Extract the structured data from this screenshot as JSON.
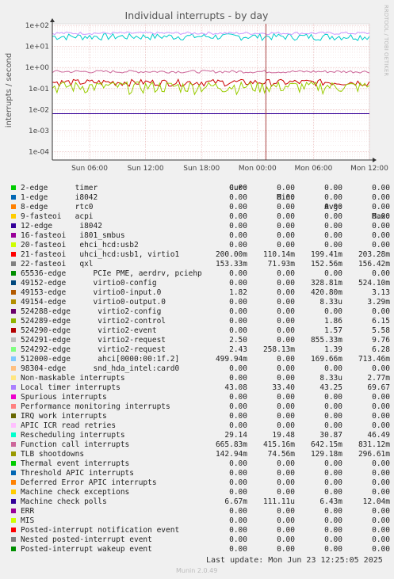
{
  "chart_data": {
    "type": "line",
    "title": "Individual interrupts - by day",
    "ylabel": "interrupts / second",
    "side_label": "RRDTOOL / TOBI OETIKER",
    "yscale": "log",
    "ylim": [
      4e-05,
      120
    ],
    "y_ticks": [
      "1e+02",
      "1e+01",
      "1e+00",
      "1e-01",
      "1e-02",
      "1e-03",
      "1e-04"
    ],
    "y_tick_values": [
      100,
      10,
      1,
      0.1,
      0.01,
      0.001,
      0.0001
    ],
    "x_ticks": [
      "Sun 06:00",
      "Sun 12:00",
      "Sun 18:00",
      "Mon 00:00",
      "Mon 06:00",
      "Mon 12:00"
    ],
    "x_tick_hours": [
      6,
      12,
      18,
      24,
      30,
      36
    ],
    "xlim_hours": [
      2,
      36
    ],
    "now_hour": 24.9,
    "series": [
      {
        "name": "Rescheduling interrupts",
        "color": "#00CCCC",
        "base": 30,
        "noise": 0.12
      },
      {
        "name": "Local timer interrupts",
        "color": "#CC99FF",
        "base": 43,
        "noise": 0.05
      },
      {
        "name": "Function call interrupts",
        "color": "#CC6699",
        "base": 0.64,
        "noise": 0.05
      },
      {
        "name": "21-fasteoi uhci_hcd:usb1, virtio1",
        "color": "#CC0000",
        "base": 0.2,
        "noise": 0.12
      },
      {
        "name": "TLB shootdowns",
        "color": "#99CC00",
        "base": 0.13,
        "noise": 0.2
      },
      {
        "name": "Machine check polls",
        "color": "#330099",
        "base": 0.0064,
        "noise": 0.0
      }
    ]
  },
  "legend": {
    "headers": {
      "cur": "Cur:",
      "min": "Min:",
      "avg": "Avg:",
      "max": "Max:"
    },
    "rows": [
      {
        "name": "2-edge      timer",
        "color": "#00CC00",
        "cur": "0.00",
        "min": "0.00",
        "avg": "0.00",
        "max": "0.00"
      },
      {
        "name": "1-edge      i8042",
        "color": "#0066B3",
        "cur": "0.00",
        "min": "0.00",
        "avg": "0.00",
        "max": "0.00"
      },
      {
        "name": "8-edge      rtc0",
        "color": "#FF8000",
        "cur": "0.00",
        "min": "0.00",
        "avg": "0.00",
        "max": "0.00"
      },
      {
        "name": "9-fasteoi   acpi",
        "color": "#FFCC00",
        "cur": "0.00",
        "min": "0.00",
        "avg": "0.00",
        "max": "0.00"
      },
      {
        "name": "12-edge      i8042",
        "color": "#330099",
        "cur": "0.00",
        "min": "0.00",
        "avg": "0.00",
        "max": "0.00"
      },
      {
        "name": "16-fasteoi   i801_smbus",
        "color": "#990099",
        "cur": "0.00",
        "min": "0.00",
        "avg": "0.00",
        "max": "0.00"
      },
      {
        "name": "20-fasteoi   ehci_hcd:usb2",
        "color": "#CCFF00",
        "cur": "0.00",
        "min": "0.00",
        "avg": "0.00",
        "max": "0.00"
      },
      {
        "name": "21-fasteoi   uhci_hcd:usb1, virtio1",
        "color": "#FF0000",
        "cur": "200.00m",
        "min": "110.14m",
        "avg": "199.41m",
        "max": "203.28m"
      },
      {
        "name": "22-fasteoi   qxl",
        "color": "#808080",
        "cur": "153.33m",
        "min": "71.93m",
        "avg": "152.56m",
        "max": "156.42m"
      },
      {
        "name": "65536-edge      PCIe PME, aerdrv, pciehp",
        "color": "#008F00",
        "cur": "0.00",
        "min": "0.00",
        "avg": "0.00",
        "max": "0.00"
      },
      {
        "name": "49152-edge      virtio0-config",
        "color": "#00487D",
        "cur": "0.00",
        "min": "0.00",
        "avg": "328.81m",
        "max": "524.10m"
      },
      {
        "name": "49153-edge      virtio0-input.0",
        "color": "#B35A00",
        "cur": "1.82",
        "min": "0.00",
        "avg": "420.80m",
        "max": "3.13"
      },
      {
        "name": "49154-edge      virtio0-output.0",
        "color": "#B38F00",
        "cur": "0.00",
        "min": "0.00",
        "avg": "8.33u",
        "max": "3.29m"
      },
      {
        "name": "524288-edge      virtio2-config",
        "color": "#6B006B",
        "cur": "0.00",
        "min": "0.00",
        "avg": "0.00",
        "max": "0.00"
      },
      {
        "name": "524289-edge      virtio2-control",
        "color": "#8FB300",
        "cur": "0.00",
        "min": "0.00",
        "avg": "1.86",
        "max": "6.15"
      },
      {
        "name": "524290-edge      virtio2-event",
        "color": "#B30000",
        "cur": "0.00",
        "min": "0.00",
        "avg": "1.57",
        "max": "5.58"
      },
      {
        "name": "524291-edge      virtio2-request",
        "color": "#BEBEBE",
        "cur": "2.50",
        "min": "0.00",
        "avg": "855.33m",
        "max": "9.76"
      },
      {
        "name": "524292-edge      virtio2-request",
        "color": "#80FF80",
        "cur": "2.43",
        "min": "258.13m",
        "avg": "1.39",
        "max": "6.28"
      },
      {
        "name": "512000-edge      ahci[0000:00:1f.2]",
        "color": "#80C9FF",
        "cur": "499.94m",
        "min": "0.00",
        "avg": "169.66m",
        "max": "713.46m"
      },
      {
        "name": "98304-edge      snd_hda_intel:card0",
        "color": "#FFC080",
        "cur": "0.00",
        "min": "0.00",
        "avg": "0.00",
        "max": "0.00"
      },
      {
        "name": "Non-maskable interrupts",
        "color": "#FFE680",
        "cur": "0.00",
        "min": "0.00",
        "avg": "8.33u",
        "max": "2.77m"
      },
      {
        "name": "Local timer interrupts",
        "color": "#AA80FF",
        "cur": "43.08",
        "min": "33.40",
        "avg": "43.25",
        "max": "69.67"
      },
      {
        "name": "Spurious interrupts",
        "color": "#EE00CC",
        "cur": "0.00",
        "min": "0.00",
        "avg": "0.00",
        "max": "0.00"
      },
      {
        "name": "Performance monitoring interrupts",
        "color": "#FF8080",
        "cur": "0.00",
        "min": "0.00",
        "avg": "0.00",
        "max": "0.00"
      },
      {
        "name": "IRQ work interrupts",
        "color": "#666600",
        "cur": "0.00",
        "min": "0.00",
        "avg": "0.00",
        "max": "0.00"
      },
      {
        "name": "APIC ICR read retries",
        "color": "#FFBFFF",
        "cur": "0.00",
        "min": "0.00",
        "avg": "0.00",
        "max": "0.00"
      },
      {
        "name": "Rescheduling interrupts",
        "color": "#00FFCC",
        "cur": "29.14",
        "min": "19.48",
        "avg": "30.87",
        "max": "46.49"
      },
      {
        "name": "Function call interrupts",
        "color": "#CC6699",
        "cur": "665.83m",
        "min": "415.16m",
        "avg": "642.15m",
        "max": "831.12m"
      },
      {
        "name": "TLB shootdowns",
        "color": "#999900",
        "cur": "142.94m",
        "min": "74.56m",
        "avg": "129.18m",
        "max": "296.61m"
      },
      {
        "name": "Thermal event interrupts",
        "color": "#00CC00",
        "cur": "0.00",
        "min": "0.00",
        "avg": "0.00",
        "max": "0.00"
      },
      {
        "name": "Threshold APIC interrupts",
        "color": "#0066B3",
        "cur": "0.00",
        "min": "0.00",
        "avg": "0.00",
        "max": "0.00"
      },
      {
        "name": "Deferred Error APIC interrupts",
        "color": "#FF8000",
        "cur": "0.00",
        "min": "0.00",
        "avg": "0.00",
        "max": "0.00"
      },
      {
        "name": "Machine check exceptions",
        "color": "#FFCC00",
        "cur": "0.00",
        "min": "0.00",
        "avg": "0.00",
        "max": "0.00"
      },
      {
        "name": "Machine check polls",
        "color": "#330099",
        "cur": "6.67m",
        "min": "111.11u",
        "avg": "6.43m",
        "max": "12.04m"
      },
      {
        "name": "ERR",
        "color": "#990099",
        "cur": "0.00",
        "min": "0.00",
        "avg": "0.00",
        "max": "0.00"
      },
      {
        "name": "MIS",
        "color": "#CCFF00",
        "cur": "0.00",
        "min": "0.00",
        "avg": "0.00",
        "max": "0.00"
      },
      {
        "name": "Posted-interrupt notification event",
        "color": "#FF0000",
        "cur": "0.00",
        "min": "0.00",
        "avg": "0.00",
        "max": "0.00"
      },
      {
        "name": "Nested posted-interrupt event",
        "color": "#808080",
        "cur": "0.00",
        "min": "0.00",
        "avg": "0.00",
        "max": "0.00"
      },
      {
        "name": "Posted-interrupt wakeup event",
        "color": "#008F00",
        "cur": "0.00",
        "min": "0.00",
        "avg": "0.00",
        "max": "0.00"
      }
    ]
  },
  "footer": {
    "last_update": "Last update: Mon Jun 23 12:25:05 2025",
    "munin": "Munin 2.0.49"
  }
}
